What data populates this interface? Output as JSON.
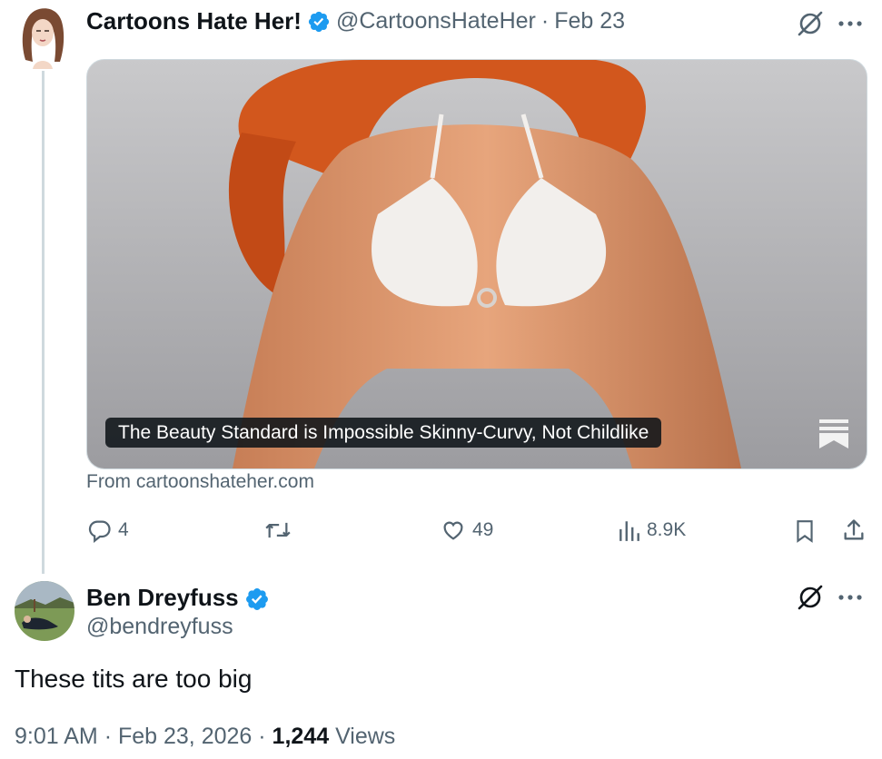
{
  "tweet": {
    "author_name": "Cartoons Hate Her!",
    "handle": "@CartoonsHateHer",
    "separator": "·",
    "date": "Feb 23",
    "card": {
      "title": "The Beauty Standard is Impossible Skinny-Curvy, Not Childlike",
      "source": "From cartoonshateher.com"
    },
    "stats": {
      "replies": "4",
      "likes": "49",
      "views": "8.9K"
    }
  },
  "reply": {
    "author_name": "Ben Dreyfuss",
    "handle": "@bendreyfuss",
    "text": "These tits are too big",
    "time": "9:01 AM",
    "sep1": "·",
    "date": "Feb 23, 2026",
    "sep2": "·",
    "views_count": "1,244",
    "views_label": "Views"
  },
  "icons": [
    "grok-icon",
    "more-icon",
    "verified-badge-icon",
    "reply-icon",
    "retweet-icon",
    "like-icon",
    "views-icon",
    "bookmark-icon",
    "share-icon",
    "article-icon"
  ],
  "colors": {
    "accent": "#1d9bf0",
    "text": "#0f1419",
    "secondary": "#536471",
    "border": "#cfd9de"
  }
}
